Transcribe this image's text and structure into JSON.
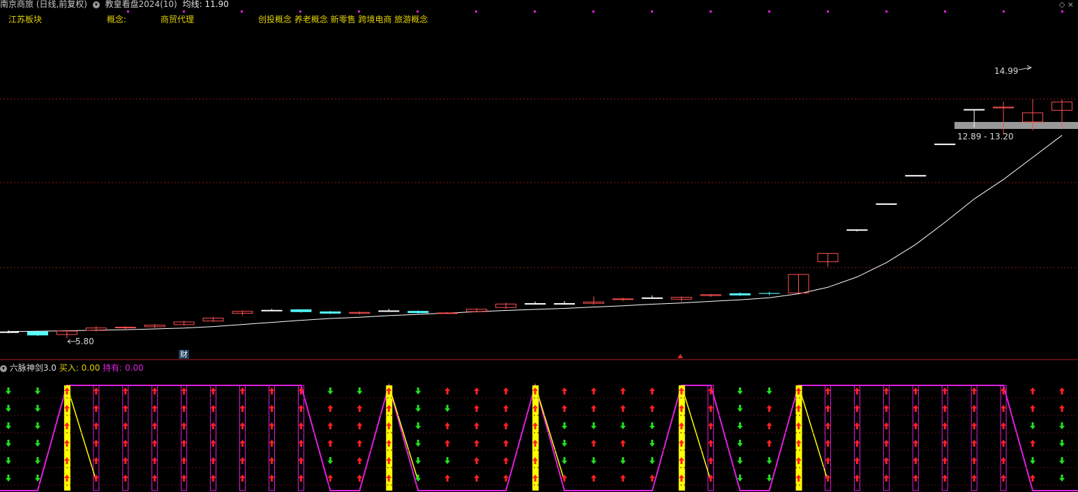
{
  "header": {
    "stock_name": "南京商旅 (日线,前复权)",
    "indicator_name": "教皇看盘2024(10)",
    "ma_label": "均线:",
    "ma_value": "11.90"
  },
  "tags": {
    "sector": "江苏板块",
    "concept_label": "概念:",
    "industry": "商贸代理",
    "concepts": "创投概念 养老概念 新零售 跨境电商 旅游概念"
  },
  "price_labels": {
    "high": "14.99",
    "low": "5.80",
    "range": "12.89 - 13.20"
  },
  "badge": "财",
  "sub_indicator": {
    "name": "六脉神剑3.0",
    "buy_label": "买入:",
    "buy_value": "0.00",
    "hold_label": "持有:",
    "hold_value": "0.00"
  },
  "colors": {
    "background": "#000000",
    "up_candle": "#ff5050",
    "down_candle": "#54ffff",
    "ma_line": "#ffffff",
    "grid": "#8b1a1a",
    "signal_up": "#ff2020",
    "signal_down": "#20e020",
    "hold_line": "#e020e0",
    "buy_bar": "#ffff00"
  },
  "candles": [
    {
      "o": 6.05,
      "h": 6.1,
      "l": 5.98,
      "c": 6.05,
      "d": "flat"
    },
    {
      "o": 6.05,
      "h": 6.08,
      "l": 5.88,
      "c": 5.9,
      "d": "down"
    },
    {
      "o": 5.92,
      "h": 6.1,
      "l": 5.8,
      "c": 6.08,
      "d": "up"
    },
    {
      "o": 6.08,
      "h": 6.26,
      "l": 6.05,
      "c": 6.2,
      "d": "up"
    },
    {
      "o": 6.19,
      "h": 6.26,
      "l": 6.12,
      "c": 6.23,
      "d": "up"
    },
    {
      "o": 6.22,
      "h": 6.33,
      "l": 6.18,
      "c": 6.31,
      "d": "up"
    },
    {
      "o": 6.3,
      "h": 6.46,
      "l": 6.28,
      "c": 6.43,
      "d": "up"
    },
    {
      "o": 6.44,
      "h": 6.62,
      "l": 6.42,
      "c": 6.58,
      "d": "up"
    },
    {
      "o": 6.74,
      "h": 6.86,
      "l": 6.66,
      "c": 6.84,
      "d": "up"
    },
    {
      "o": 6.88,
      "h": 6.92,
      "l": 6.84,
      "c": 6.88,
      "d": "flat"
    },
    {
      "o": 6.9,
      "h": 6.9,
      "l": 6.78,
      "c": 6.8,
      "d": "down"
    },
    {
      "o": 6.82,
      "h": 6.84,
      "l": 6.72,
      "c": 6.74,
      "d": "down"
    },
    {
      "o": 6.74,
      "h": 6.82,
      "l": 6.7,
      "c": 6.8,
      "d": "up"
    },
    {
      "o": 6.86,
      "h": 6.92,
      "l": 6.82,
      "c": 6.86,
      "d": "flat"
    },
    {
      "o": 6.84,
      "h": 6.86,
      "l": 6.74,
      "c": 6.76,
      "d": "down"
    },
    {
      "o": 6.76,
      "h": 6.8,
      "l": 6.74,
      "c": 6.78,
      "d": "up"
    },
    {
      "o": 6.8,
      "h": 6.94,
      "l": 6.78,
      "c": 6.92,
      "d": "up"
    },
    {
      "o": 6.96,
      "h": 7.16,
      "l": 6.92,
      "c": 7.12,
      "d": "up"
    },
    {
      "o": 7.14,
      "h": 7.2,
      "l": 7.1,
      "c": 7.14,
      "d": "flat"
    },
    {
      "o": 7.14,
      "h": 7.22,
      "l": 7.08,
      "c": 7.14,
      "d": "flat"
    },
    {
      "o": 7.12,
      "h": 7.4,
      "l": 7.08,
      "c": 7.2,
      "d": "up"
    },
    {
      "o": 7.28,
      "h": 7.35,
      "l": 7.22,
      "c": 7.32,
      "d": "up"
    },
    {
      "o": 7.36,
      "h": 7.44,
      "l": 7.32,
      "c": 7.36,
      "d": "flat"
    },
    {
      "o": 7.28,
      "h": 7.4,
      "l": 7.2,
      "c": 7.38,
      "d": "up"
    },
    {
      "o": 7.42,
      "h": 7.5,
      "l": 7.38,
      "c": 7.48,
      "d": "up"
    },
    {
      "o": 7.52,
      "h": 7.55,
      "l": 7.42,
      "c": 7.44,
      "d": "down"
    },
    {
      "o": 7.53,
      "h": 7.58,
      "l": 7.45,
      "c": 7.5,
      "d": "down"
    },
    {
      "o": 7.52,
      "h": 8.26,
      "l": 7.52,
      "c": 8.26,
      "d": "up"
    },
    {
      "o": 8.72,
      "h": 9.07,
      "l": 8.55,
      "c": 9.07,
      "d": "up"
    },
    {
      "o": 9.98,
      "h": 9.98,
      "l": 9.9,
      "c": 9.98,
      "d": "flat"
    },
    {
      "o": 10.98,
      "h": 10.98,
      "l": 10.98,
      "c": 10.98,
      "d": "flat"
    },
    {
      "o": 12.07,
      "h": 12.07,
      "l": 12.07,
      "c": 12.07,
      "d": "flat"
    },
    {
      "o": 13.28,
      "h": 13.28,
      "l": 13.28,
      "c": 13.28,
      "d": "flat"
    },
    {
      "o": 14.61,
      "h": 14.61,
      "l": 13.9,
      "c": 14.61,
      "d": "flat"
    },
    {
      "o": 14.64,
      "h": 14.9,
      "l": 13.62,
      "c": 14.7,
      "d": "up"
    },
    {
      "o": 14.1,
      "h": 14.99,
      "l": 13.8,
      "c": 14.48,
      "d": "up"
    },
    {
      "o": 14.55,
      "h": 14.98,
      "l": 13.92,
      "c": 14.9,
      "d": "up"
    }
  ],
  "ma_values": [
    6.05,
    6.06,
    6.08,
    6.1,
    6.12,
    6.15,
    6.18,
    6.24,
    6.32,
    6.4,
    6.48,
    6.55,
    6.6,
    6.66,
    6.71,
    6.76,
    6.81,
    6.86,
    6.9,
    6.94,
    6.99,
    7.04,
    7.1,
    7.15,
    7.21,
    7.27,
    7.35,
    7.5,
    7.75,
    8.15,
    8.7,
    9.4,
    10.25,
    11.15,
    11.9,
    12.75,
    13.6
  ],
  "signals": {
    "buy_days": [
      2,
      13,
      18,
      23,
      27
    ],
    "hold_starts": [
      2,
      13,
      18,
      23,
      27
    ],
    "hold_ends": [
      10,
      13,
      18,
      24,
      34
    ],
    "rows": [
      [
        0,
        0,
        1,
        1,
        1,
        1,
        1,
        1,
        1,
        1,
        1,
        0,
        0,
        1,
        0,
        1,
        1,
        1,
        1,
        1,
        1,
        1,
        1,
        1,
        1,
        0,
        0,
        1,
        1,
        1,
        1,
        1,
        1,
        1,
        1,
        1,
        1
      ],
      [
        0,
        0,
        1,
        1,
        1,
        1,
        1,
        1,
        1,
        1,
        1,
        1,
        1,
        1,
        0,
        0,
        1,
        1,
        1,
        1,
        1,
        1,
        1,
        1,
        1,
        0,
        1,
        1,
        1,
        1,
        1,
        1,
        1,
        1,
        1,
        1,
        1
      ],
      [
        0,
        0,
        1,
        1,
        1,
        1,
        1,
        1,
        1,
        1,
        1,
        1,
        1,
        1,
        0,
        1,
        1,
        1,
        1,
        0,
        0,
        0,
        0,
        1,
        1,
        0,
        1,
        1,
        1,
        1,
        1,
        1,
        1,
        1,
        1,
        0,
        0
      ],
      [
        0,
        0,
        1,
        1,
        1,
        1,
        1,
        1,
        1,
        1,
        1,
        1,
        1,
        1,
        0,
        1,
        1,
        1,
        1,
        0,
        1,
        1,
        0,
        1,
        1,
        0,
        1,
        1,
        1,
        1,
        1,
        1,
        1,
        1,
        1,
        1,
        0
      ],
      [
        0,
        0,
        1,
        1,
        1,
        1,
        1,
        1,
        1,
        1,
        1,
        0,
        1,
        1,
        0,
        0,
        1,
        1,
        1,
        0,
        0,
        0,
        0,
        1,
        1,
        0,
        0,
        1,
        1,
        1,
        1,
        1,
        1,
        1,
        1,
        0,
        0
      ],
      [
        0,
        0,
        1,
        1,
        1,
        1,
        1,
        1,
        1,
        1,
        1,
        1,
        1,
        1,
        0,
        1,
        1,
        1,
        1,
        1,
        1,
        1,
        1,
        1,
        1,
        0,
        0,
        1,
        1,
        1,
        1,
        1,
        1,
        1,
        1,
        1,
        0
      ]
    ]
  }
}
